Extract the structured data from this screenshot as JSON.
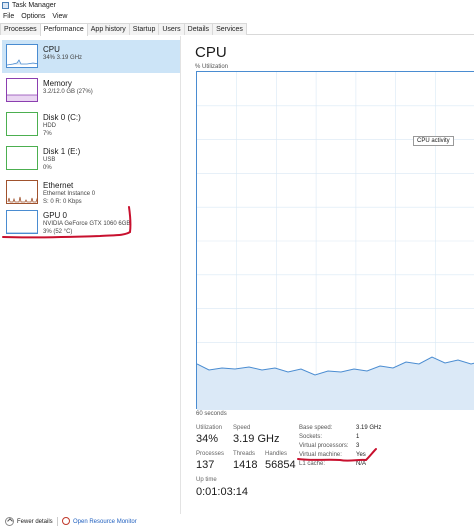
{
  "window": {
    "title": "Task Manager"
  },
  "menu": [
    "File",
    "Options",
    "View"
  ],
  "tabs": [
    "Processes",
    "Performance",
    "App history",
    "Startup",
    "Users",
    "Details",
    "Services"
  ],
  "sidebar": {
    "items": [
      {
        "name": "CPU",
        "line1": "34% 3.19 GHz",
        "line2": ""
      },
      {
        "name": "Memory",
        "line1": "3.2/12.0 GB (27%)",
        "line2": ""
      },
      {
        "name": "Disk 0 (C:)",
        "line1": "HDD",
        "line2": "7%"
      },
      {
        "name": "Disk 1 (E:)",
        "line1": "USB",
        "line2": "0%"
      },
      {
        "name": "Ethernet",
        "line1": "Ethernet Instance 0",
        "line2": "S: 0 R: 0 Kbps"
      },
      {
        "name": "GPU 0",
        "line1": "NVIDIA GeForce GTX 1060 6GB",
        "line2": "3% (52 °C)"
      }
    ]
  },
  "main": {
    "title": "CPU",
    "util_axis_label": "% Utilization",
    "tooltip": "CPU activity",
    "time_axis_label": "60 seconds",
    "stats": {
      "utilization_label": "Utilization",
      "utilization": "34%",
      "speed_label": "Speed",
      "speed": "3.19 GHz",
      "processes_label": "Processes",
      "processes": "137",
      "threads_label": "Threads",
      "threads": "1418",
      "handles_label": "Handles",
      "handles": "56854",
      "uptime_label": "Up time",
      "uptime": "0:01:03:14"
    },
    "specs": [
      {
        "label": "Base speed:",
        "value": "3.19 GHz"
      },
      {
        "label": "Sockets:",
        "value": "1"
      },
      {
        "label": "Virtual processors:",
        "value": "3"
      },
      {
        "label": "Virtual machine:",
        "value": "Yes"
      },
      {
        "label": "L1 cache:",
        "value": "N/A"
      }
    ]
  },
  "footer": {
    "fewer_details": "Fewer details",
    "open_resource_monitor": "Open Resource Monitor"
  },
  "colors": {
    "cpu": "#4a8cd1",
    "memory": "#8b3fb0",
    "disk": "#4caf50",
    "ethernet": "#a0522d",
    "gpu": "#4a8cd1",
    "selected": "#cce4f7",
    "annotation": "#c8102e"
  }
}
